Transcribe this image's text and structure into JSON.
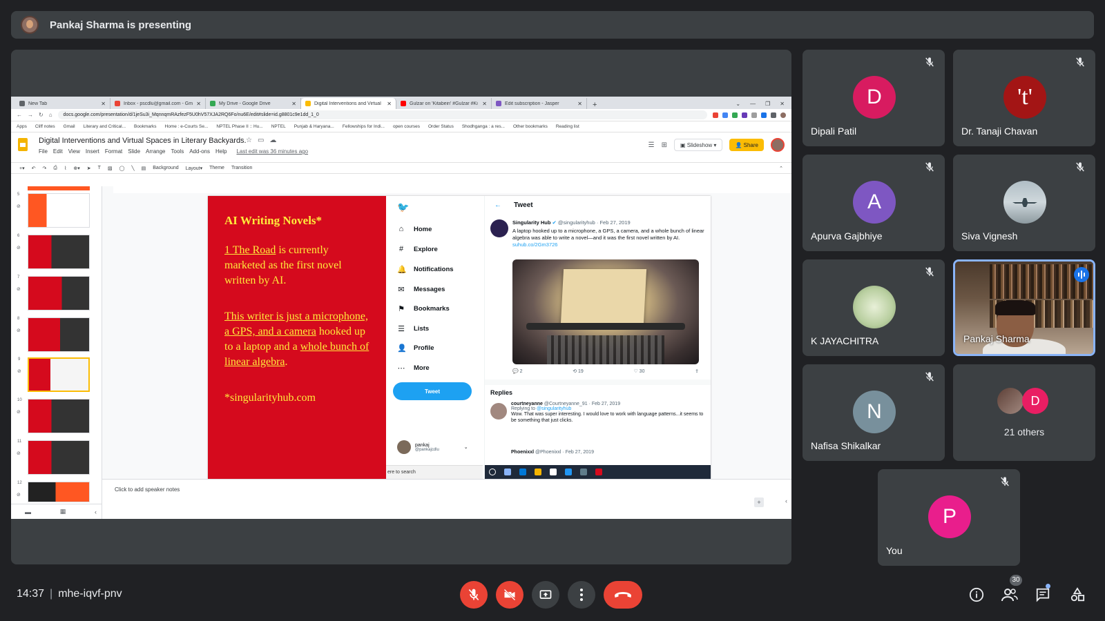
{
  "presenting_banner": "Pankaj Sharma is presenting",
  "browser": {
    "tabs": [
      "New Tab",
      "Inbox - pscdlu@gmail.com - Gm",
      "My Drive - Google Drive",
      "Digital Interventions and Virtual",
      "Gulzar on 'Kitabein' #Gulzar #Ki",
      "Edit subscription - Jasper"
    ],
    "url": "docs.google.com/presentation/d/1jeSu3i_MqnnqmRAzfezF5U0hV57XJA2RQ6Fo/nu6E/edit#slide=id.g8801c9e1dd_1_0",
    "bookmarks": [
      "Apps",
      "Cliff notes",
      "Gmail",
      "Literary and Critical...",
      "Bookmarks",
      "Home : e-Courts Se...",
      "NPTEL Phase II :: Hu...",
      "NPTEL",
      "Punjab & Haryana...",
      "Fellowships for Indi...",
      "open courses",
      "Order Status",
      "Shodhganga : a res...",
      "Other bookmarks",
      "Reading list"
    ]
  },
  "slides_app": {
    "doc_title": "Digital Interventions and Virtual Spaces in Literary Backyards.",
    "menu": [
      "File",
      "Edit",
      "View",
      "Insert",
      "Format",
      "Slide",
      "Arrange",
      "Tools",
      "Add-ons",
      "Help"
    ],
    "last_edit": "Last edit was 36 minutes ago",
    "slideshow_label": "Slideshow",
    "share_label": "Share",
    "toolbar": [
      "Background",
      "Layout▾",
      "Theme",
      "Transition"
    ],
    "slide_numbers": [
      "5",
      "6",
      "7",
      "8",
      "9",
      "10",
      "11",
      "12"
    ],
    "speaker_notes": "Click to add speaker notes"
  },
  "slide": {
    "title": "AI Writing Novels*",
    "p1_link": "1 The Road",
    "p1_rest": " is currently marketed as the first novel written by AI.",
    "p2_link1": "This writer is just a microphone, a GPS, and a camera",
    "p2_mid": " hooked up to a laptop and a ",
    "p2_link2": "whole bunch of linear algebra",
    "p2_end": ".",
    "footnote": "*singularityhub.com"
  },
  "twitter": {
    "nav": [
      "Home",
      "Explore",
      "Notifications",
      "Messages",
      "Bookmarks",
      "Lists",
      "Profile",
      "More"
    ],
    "tweet_button": "Tweet",
    "user_name": "pankaj",
    "user_handle": "@pankajcdlu",
    "search": "ere to search",
    "header": "Tweet",
    "post_author": "Singularity Hub",
    "post_meta": "@singularityhub · Feb 27, 2019",
    "post_text": "A laptop hooked up to a microphone, a GPS, a camera, and a whole bunch of linear algebra was able to write a novel—and it was the first novel written by AI.",
    "post_link": "suhub.co/2Gm3726",
    "post_actions": [
      "2",
      "19",
      "30"
    ],
    "replies_label": "Replies",
    "reply1_author": "courtneyanne",
    "reply1_meta": "@Courtneyanne_91 · Feb 27, 2019",
    "reply1_replying": "Replying to",
    "reply1_to": "@singularityhub",
    "reply1_text": "Wow. That was super interesting. I would love to work with language patterns...it seems to be something that just clicks.",
    "reply2_author": "Phoenixxl",
    "reply2_meta": "@Phoenixxl · Feb 27, 2019"
  },
  "participants": [
    {
      "name": "Dipali Patil",
      "initial": "D",
      "color": "#d81b60"
    },
    {
      "name": "Dr. Tanaji Chavan",
      "initial": "'t'",
      "color": "#a31515"
    },
    {
      "name": "Apurva Gajbhiye",
      "initial": "A",
      "color": "#7e57c2"
    },
    {
      "name": "Siva Vignesh",
      "initial": "",
      "color": "#90a4ae"
    },
    {
      "name": "K JAYACHITRA",
      "initial": "",
      "color": "#c5d6b0"
    },
    {
      "name": "Pankaj Sharma",
      "initial": "",
      "color": ""
    },
    {
      "name": "Nafisa Shikalkar",
      "initial": "N",
      "color": "#78909c"
    },
    {
      "name": "21 others",
      "initial": "D",
      "color": "#e91e63"
    },
    {
      "name": "You",
      "initial": "P",
      "color": "#e91e8c"
    }
  ],
  "meeting": {
    "time": "14:37",
    "code": "mhe-iqvf-pnv",
    "participant_count": "30"
  },
  "colors": {
    "end_call": "#ea4335",
    "tile_bg": "#3c4043",
    "slide_red": "#d50a1d",
    "slide_text": "#ffeb3b"
  }
}
